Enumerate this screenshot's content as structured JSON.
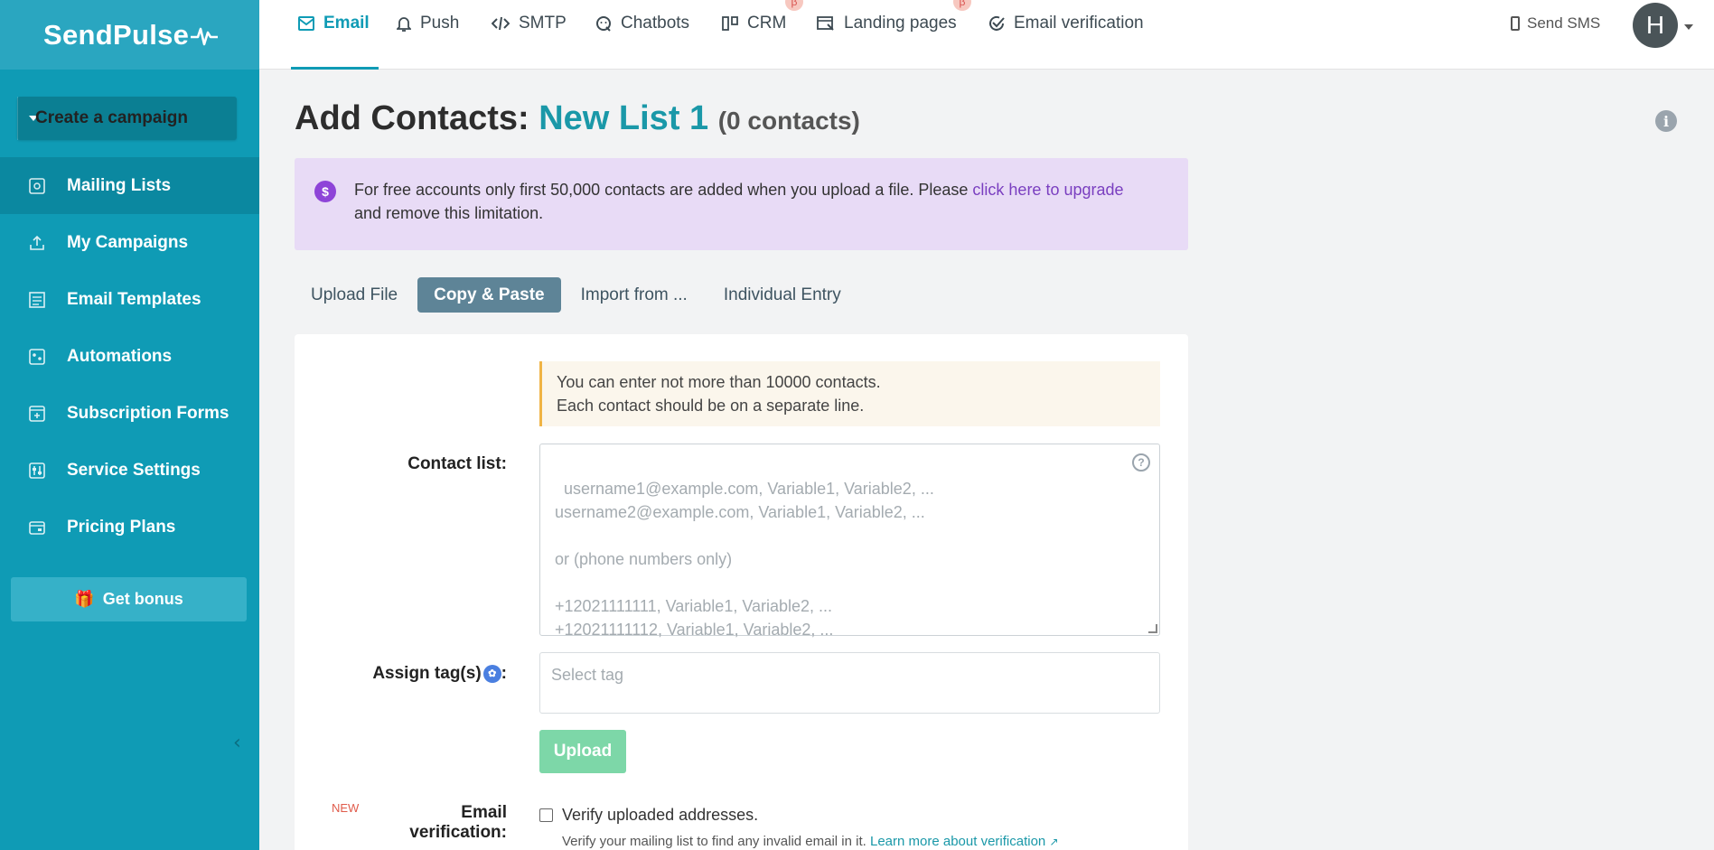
{
  "brand": {
    "name": "SendPulse",
    "accent": "#0f9bb5"
  },
  "sidebar": {
    "create_campaign": "Create a campaign",
    "items": [
      {
        "label": "Mailing Lists",
        "icon": "mailing-lists-icon",
        "active": true
      },
      {
        "label": "My Campaigns",
        "icon": "campaigns-icon"
      },
      {
        "label": "Email Templates",
        "icon": "templates-icon"
      },
      {
        "label": "Automations",
        "icon": "automations-icon"
      },
      {
        "label": "Subscription Forms",
        "icon": "forms-icon"
      },
      {
        "label": "Service Settings",
        "icon": "settings-icon"
      },
      {
        "label": "Pricing Plans",
        "icon": "pricing-icon"
      }
    ],
    "bonus": "Get bonus"
  },
  "topnav": {
    "tabs": [
      {
        "label": "Email",
        "active": true
      },
      {
        "label": "Push"
      },
      {
        "label": "SMTP"
      },
      {
        "label": "Chatbots"
      },
      {
        "label": "CRM",
        "beta": "β"
      },
      {
        "label": "Landing pages",
        "beta": "β"
      },
      {
        "label": "Email verification"
      }
    ],
    "send_sms": "Send SMS",
    "avatar_initial": "H"
  },
  "page": {
    "title_prefix": "Add Contacts:",
    "list_name": "New List 1",
    "count": "(0 contacts)"
  },
  "notice": {
    "text_before": "For free accounts only first 50,000 contacts are added when you upload a file. Please ",
    "link": "click here to upgrade",
    "text_after": "and remove this limitation."
  },
  "subtabs": [
    {
      "label": "Upload File"
    },
    {
      "label": "Copy & Paste",
      "active": true
    },
    {
      "label": "Import from ..."
    },
    {
      "label": "Individual Entry"
    }
  ],
  "form": {
    "hint_line1": "You can enter not more than 10000 contacts.",
    "hint_line2": "Each contact should be on a separate line.",
    "contact_list_label": "Contact list:",
    "contact_placeholder": "username1@example.com, Variable1, Variable2, ...\nusername2@example.com, Variable1, Variable2, ...\n\nor (phone numbers only)\n\n+12021111111, Variable1, Variable2, ...\n+12021111112, Variable1, Variable2, ...",
    "assign_tags_label": "Assign tag(s)",
    "tag_placeholder": "Select tag",
    "upload_button": "Upload",
    "new_badge": "NEW",
    "email_verification_label": "Email verification:",
    "verify_checkbox_label": "Verify uploaded addresses.",
    "verify_note": "Verify your mailing list to find any invalid email in it. ",
    "verify_link": "Learn more about verification"
  }
}
